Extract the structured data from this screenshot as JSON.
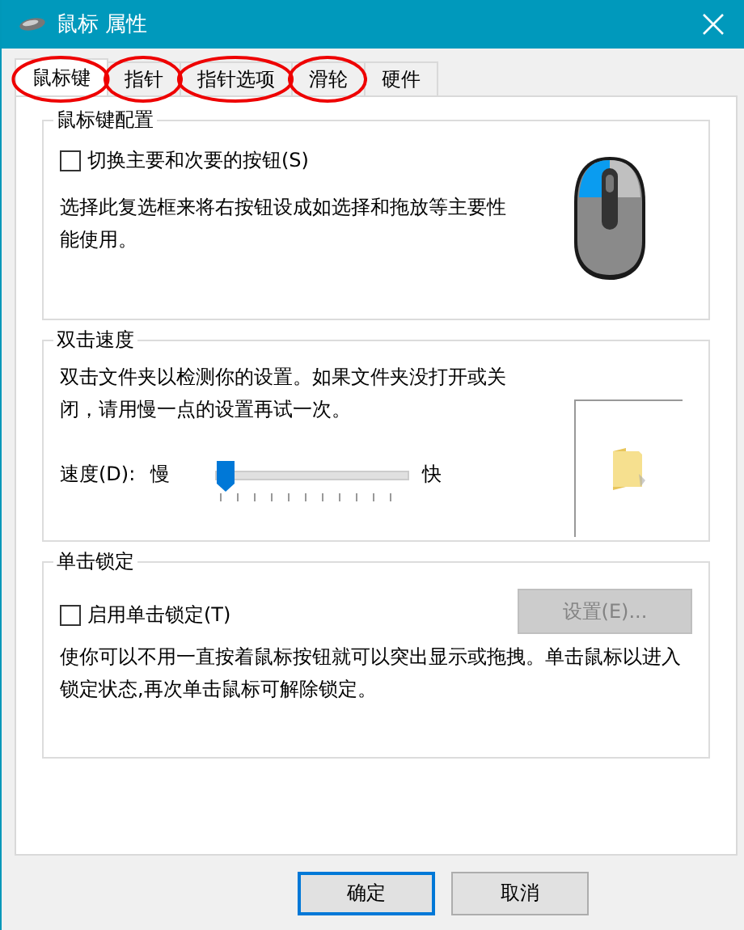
{
  "window": {
    "title": "鼠标 属性"
  },
  "tabs": [
    {
      "label": "鼠标键",
      "selected": true,
      "circled": true
    },
    {
      "label": "指针",
      "selected": false,
      "circled": true
    },
    {
      "label": "指针选项",
      "selected": false,
      "circled": true
    },
    {
      "label": "滑轮",
      "selected": false,
      "circled": true
    },
    {
      "label": "硬件",
      "selected": false,
      "circled": false
    }
  ],
  "button_config": {
    "title": "鼠标键配置",
    "checkbox": {
      "label": "切换主要和次要的按钮(S)",
      "checked": false
    },
    "description": "选择此复选框来将右按钮设成如选择和拖放等主要性能使用。"
  },
  "double_click": {
    "title": "双击速度",
    "description": "双击文件夹以检测你的设置。如果文件夹没打开或关闭，请用慢一点的设置再试一次。",
    "speed_label": "速度(D):",
    "slow_label": "慢",
    "fast_label": "快",
    "slider": {
      "level": 0.03
    }
  },
  "click_lock": {
    "title": "单击锁定",
    "checkbox": {
      "label": "启用单击锁定(T)",
      "checked": false
    },
    "settings_button": {
      "label": "设置(E)...",
      "disabled": true
    },
    "description": "使你可以不用一直按着鼠标按钮就可以突出显示或拖拽。单击鼠标以进入锁定状态,再次单击鼠标可解除锁定。"
  },
  "buttons": [
    {
      "label": "确定",
      "default": true
    },
    {
      "label": "取消",
      "default": false
    }
  ]
}
